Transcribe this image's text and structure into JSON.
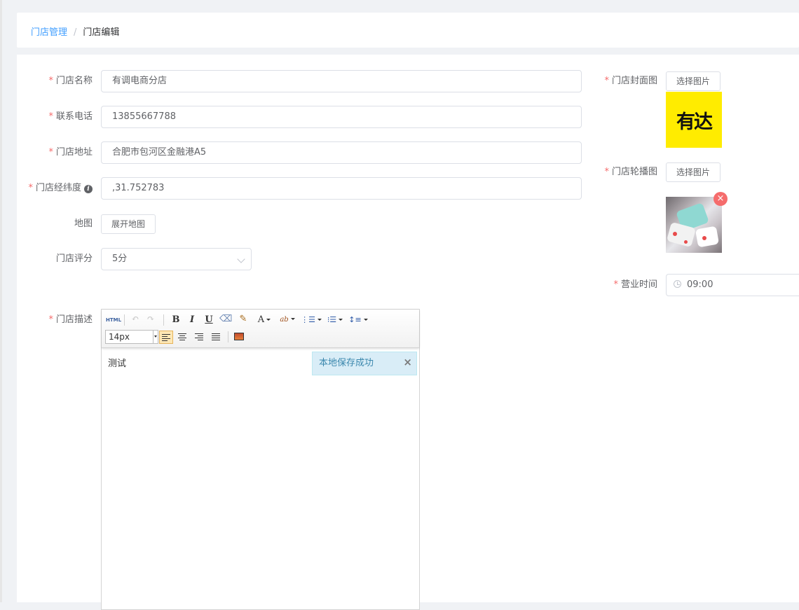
{
  "breadcrumb": {
    "parent": "门店管理",
    "separator": "/",
    "current": "门店编辑"
  },
  "form": {
    "name": {
      "label": "门店名称",
      "value": "有调电商分店",
      "required": true
    },
    "phone": {
      "label": "联系电话",
      "value": "13855667788",
      "required": true
    },
    "address": {
      "label": "门店地址",
      "value": "合肥市包河区金融港A5",
      "required": true
    },
    "coords": {
      "label": "门店经纬度",
      "value": ",31.752783",
      "required": true,
      "info_icon": "i"
    },
    "map": {
      "label": "地图",
      "button": "展开地图"
    },
    "rating": {
      "label": "门店评分",
      "value": "5分"
    },
    "description": {
      "label": "门店描述",
      "required": true,
      "content": "测试"
    },
    "cover": {
      "label": "门店封面图",
      "button": "选择图片",
      "required": true,
      "logo_text": "有达",
      "logo_bg": "#ffec00"
    },
    "carousel": {
      "label": "门店轮播图",
      "button": "选择图片",
      "required": true,
      "remove": "×"
    },
    "hours": {
      "label": "营业时间",
      "value": "09:00",
      "required": true
    }
  },
  "editor": {
    "toolbar": {
      "html": "HTML",
      "undo": "↶",
      "redo": "↷",
      "bold": "B",
      "italic": "I",
      "underline": "U",
      "eraser": "⌫",
      "brush": "✎",
      "fontcolor": "A",
      "highlight": "ab",
      "ordered_list": "⋮☰",
      "unordered_list": "⁝☰",
      "line_height": "↕≡"
    },
    "font_size": "14px",
    "toast": {
      "text": "本地保存成功",
      "close": "×"
    }
  },
  "colors": {
    "accent": "#409eff",
    "required": "#f56c6c",
    "toast_bg": "#d9edf7"
  }
}
